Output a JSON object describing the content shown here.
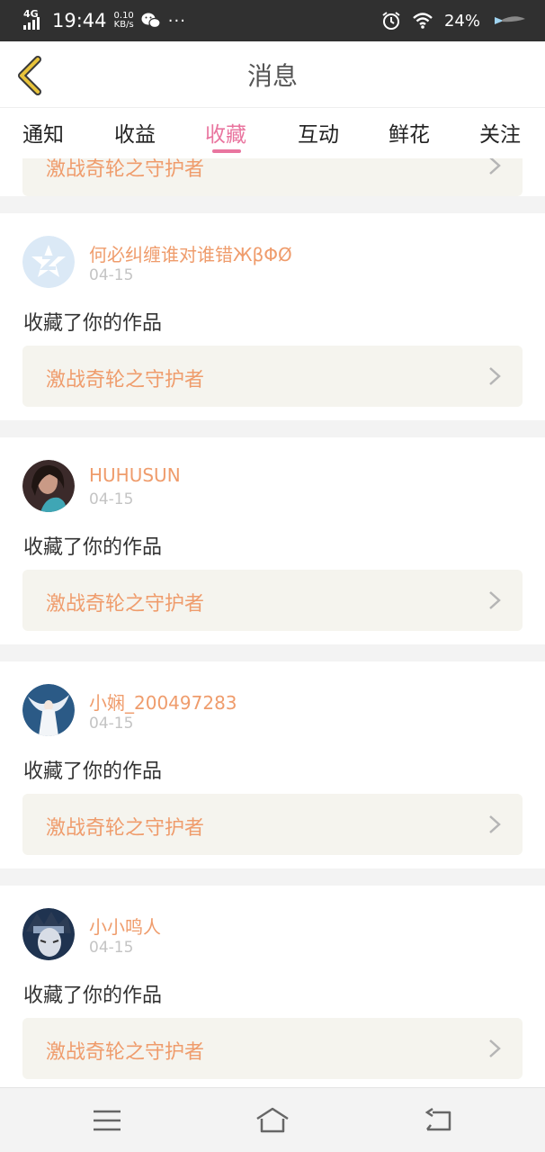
{
  "status_bar": {
    "network": "4G",
    "time": "19:44",
    "speed_value": "0.10",
    "speed_unit": "KB/s",
    "more": "···",
    "battery": "24%"
  },
  "header": {
    "title": "消息"
  },
  "tabs": [
    {
      "label": "通知"
    },
    {
      "label": "收益"
    },
    {
      "label": "收藏",
      "active": true
    },
    {
      "label": "互动"
    },
    {
      "label": "鲜花"
    },
    {
      "label": "关注"
    }
  ],
  "items": [
    {
      "username": "何必纠缠谁对谁错ЖβΦØ",
      "date": "04-15",
      "action": "收藏了你的作品",
      "work_title": "激战奇轮之守护者",
      "avatar": "default-z-avatar"
    },
    {
      "username": "HUHUSUN",
      "date": "04-15",
      "action": "收藏了你的作品",
      "work_title": "激战奇轮之守护者",
      "avatar": "photo-avatar"
    },
    {
      "username": "小娴_200497283",
      "date": "04-15",
      "action": "收藏了你的作品",
      "work_title": "激战奇轮之守护者",
      "avatar": "anime-angel-avatar"
    },
    {
      "username": "小小鸣人",
      "date": "04-15",
      "action": "收藏了你的作品",
      "work_title": "激战奇轮之守护者",
      "avatar": "anime-ninja-avatar"
    }
  ],
  "partial_item": {
    "work_title": "激战奇轮之守护者"
  },
  "colors": {
    "accent": "#e9759f",
    "username": "#ef9c6c",
    "back_arrow": "#e8c33a"
  }
}
